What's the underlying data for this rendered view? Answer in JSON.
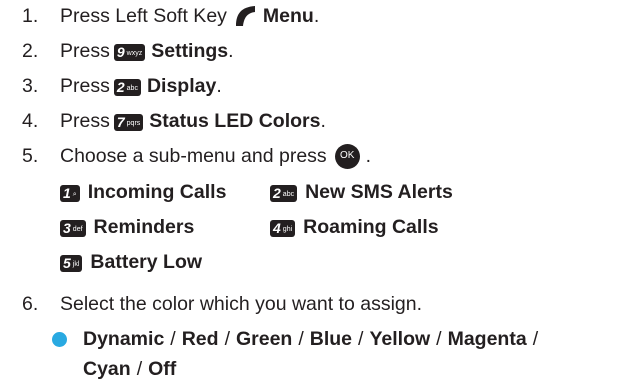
{
  "steps": [
    {
      "num": "1.",
      "pre": "Press Left Soft Key ",
      "icon": "left-soft-key-icon",
      "label": "Menu",
      "post": "."
    },
    {
      "num": "2.",
      "pre": "Press ",
      "key": {
        "digit": "9",
        "letters": "wxyz"
      },
      "label": "Settings",
      "post": "."
    },
    {
      "num": "3.",
      "pre": "Press ",
      "key": {
        "digit": "2",
        "letters": "abc"
      },
      "label": "Display",
      "post": "."
    },
    {
      "num": "4.",
      "pre": "Press ",
      "key": {
        "digit": "7",
        "letters": "pqrs"
      },
      "label": "Status LED Colors",
      "post": "."
    },
    {
      "num": "5.",
      "pre": "Choose a sub-menu and press",
      "icon": "ok-key-icon",
      "ok_label": "OK",
      "post": "."
    },
    {
      "num": "6.",
      "pre": "Select the color which you want to assign."
    }
  ],
  "submenu": [
    {
      "digit": "1",
      "letters": "⌕",
      "label": "Incoming Calls"
    },
    {
      "digit": "2",
      "letters": "abc",
      "label": "New SMS Alerts"
    },
    {
      "digit": "3",
      "letters": "def",
      "label": "Reminders"
    },
    {
      "digit": "4",
      "letters": "ghi",
      "label": "Roaming Calls"
    },
    {
      "digit": "5",
      "letters": "jkl",
      "label": "Battery Low"
    }
  ],
  "colors": {
    "line1": [
      "Dynamic",
      "Red",
      "Green",
      "Blue",
      "Yellow",
      "Magenta"
    ],
    "line2": [
      "Cyan",
      "Off"
    ],
    "separator": "/"
  },
  "style": {
    "text_color": "#231f20",
    "bullet_color": "#29a9e1"
  }
}
